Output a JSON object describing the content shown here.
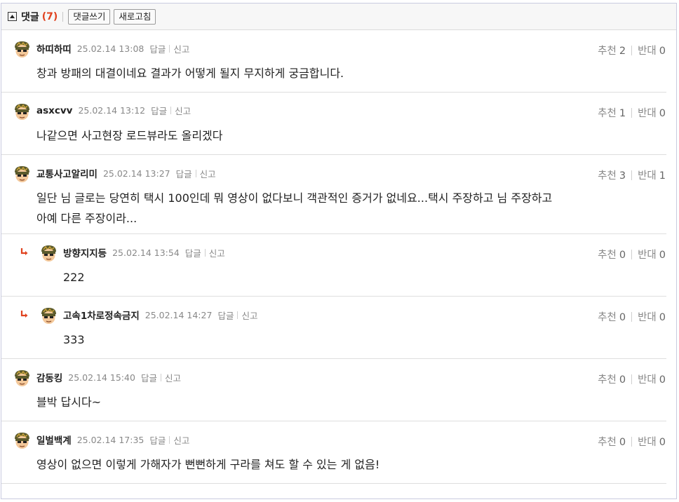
{
  "header": {
    "title": "댓글",
    "count": "(7)",
    "write_label": "댓글쓰기",
    "refresh_label": "새로고침"
  },
  "labels": {
    "reply": "답글",
    "report": "신고",
    "up": "추천",
    "down": "반대"
  },
  "comments": [
    {
      "nick": "하띠하띠",
      "date": "25.02.14 13:08",
      "text": "창과 방패의 대결이네요 결과가 어떻게 될지 무지하게 궁금합니다.",
      "up": "2",
      "down": "0",
      "reply": false
    },
    {
      "nick": "asxcvv",
      "date": "25.02.14 13:12",
      "text": "나같으면 사고현장 로드뷰라도 올리겠다",
      "up": "1",
      "down": "0",
      "reply": false
    },
    {
      "nick": "교통사고알리미",
      "date": "25.02.14 13:27",
      "text": "일단 님 글로는 당연히 택시 100인데 뭐 영상이 없다보니 객관적인 증거가 없네요...택시 주장하고 님 주장하고",
      "text2": "아예 다른 주장이라...",
      "up": "3",
      "down": "1",
      "reply": false
    },
    {
      "nick": "방향지지등",
      "date": "25.02.14 13:54",
      "text": "222",
      "up": "0",
      "down": "0",
      "reply": true
    },
    {
      "nick": "고속1차로정속금지",
      "date": "25.02.14 14:27",
      "text": "333",
      "up": "0",
      "down": "0",
      "reply": true
    },
    {
      "nick": "감동킹",
      "date": "25.02.14 15:40",
      "text": "블박 답시다~",
      "up": "0",
      "down": "0",
      "reply": false
    },
    {
      "nick": "일벌백계",
      "date": "25.02.14 17:35",
      "text": "영상이 없으면 이렇게 가해자가 뻔뻔하게 구라를 쳐도 할 수 있는 게 없음!",
      "up": "0",
      "down": "0",
      "reply": false
    }
  ],
  "colors": {
    "count": "#e0421f",
    "reply_arrow": "#e0421f"
  },
  "icons": {
    "toggle": "collapse-up-icon",
    "avatar": "level-avatar-icon",
    "reply": "reply-arrow-icon"
  }
}
